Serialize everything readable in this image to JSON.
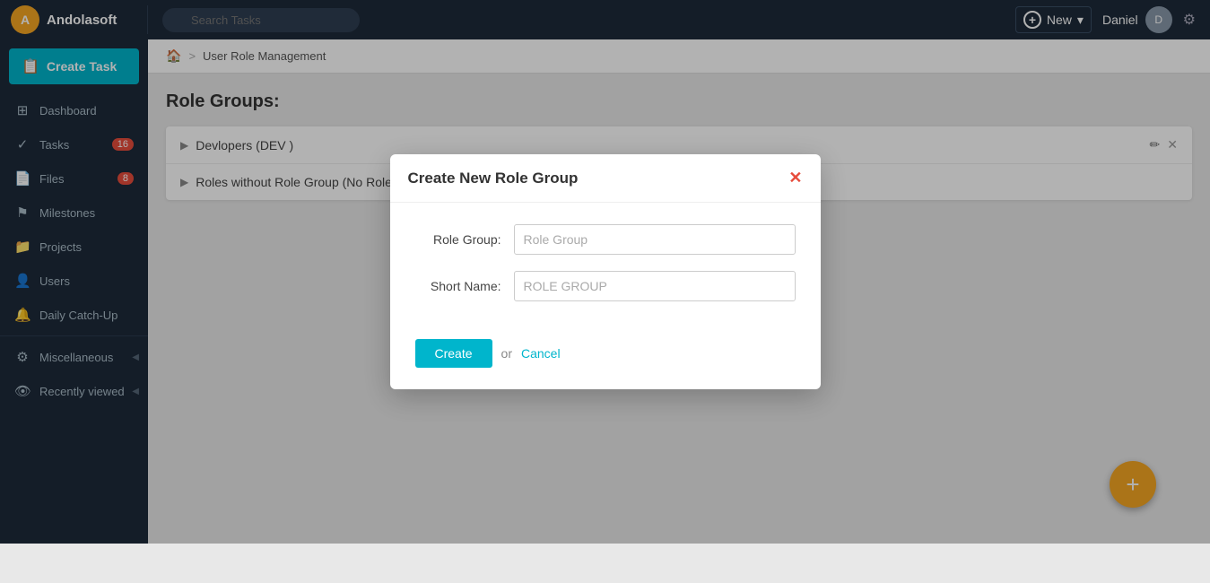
{
  "brand": {
    "logo_text": "A",
    "name": "Andolasoft"
  },
  "navbar": {
    "search_placeholder": "Search Tasks",
    "new_button": "New",
    "user_name": "Daniel",
    "settings_tooltip": "Settings"
  },
  "sidebar": {
    "create_task": "Create Task",
    "nav_items": [
      {
        "id": "dashboard",
        "label": "Dashboard",
        "icon": "⊞",
        "badge": null
      },
      {
        "id": "tasks",
        "label": "Tasks",
        "icon": "✓",
        "badge": "16"
      },
      {
        "id": "files",
        "label": "Files",
        "icon": "📄",
        "badge": "8"
      },
      {
        "id": "milestones",
        "label": "Milestones",
        "icon": "🚩",
        "badge": null
      },
      {
        "id": "projects",
        "label": "Projects",
        "icon": "📁",
        "badge": null
      },
      {
        "id": "users",
        "label": "Users",
        "icon": "👤",
        "badge": null
      },
      {
        "id": "daily-catchup",
        "label": "Daily Catch-Up",
        "icon": "🔔",
        "badge": null
      },
      {
        "id": "miscellaneous",
        "label": "Miscellaneous",
        "icon": "⚙",
        "badge": null,
        "arrow": true
      },
      {
        "id": "recently-viewed",
        "label": "Recently viewed",
        "icon": "👁",
        "badge": null,
        "arrow": true
      }
    ]
  },
  "breadcrumb": {
    "home": "home",
    "separator": ">",
    "current": "User Role Management"
  },
  "page": {
    "title": "Role Groups:"
  },
  "role_groups": [
    {
      "name": "Devlopers  (DEV )",
      "short": "DEV",
      "has_actions": true
    },
    {
      "name": "Roles without Role Group  (No Role)",
      "short": "No Role",
      "has_actions": false
    }
  ],
  "fab": {
    "icon": "+"
  },
  "modal": {
    "title": "Create New Role Group",
    "role_group_label": "Role Group:",
    "role_group_placeholder": "Role Group",
    "short_name_label": "Short Name:",
    "short_name_placeholder": "ROLE GROUP",
    "create_button": "Create",
    "or_text": "or",
    "cancel_button": "Cancel"
  }
}
